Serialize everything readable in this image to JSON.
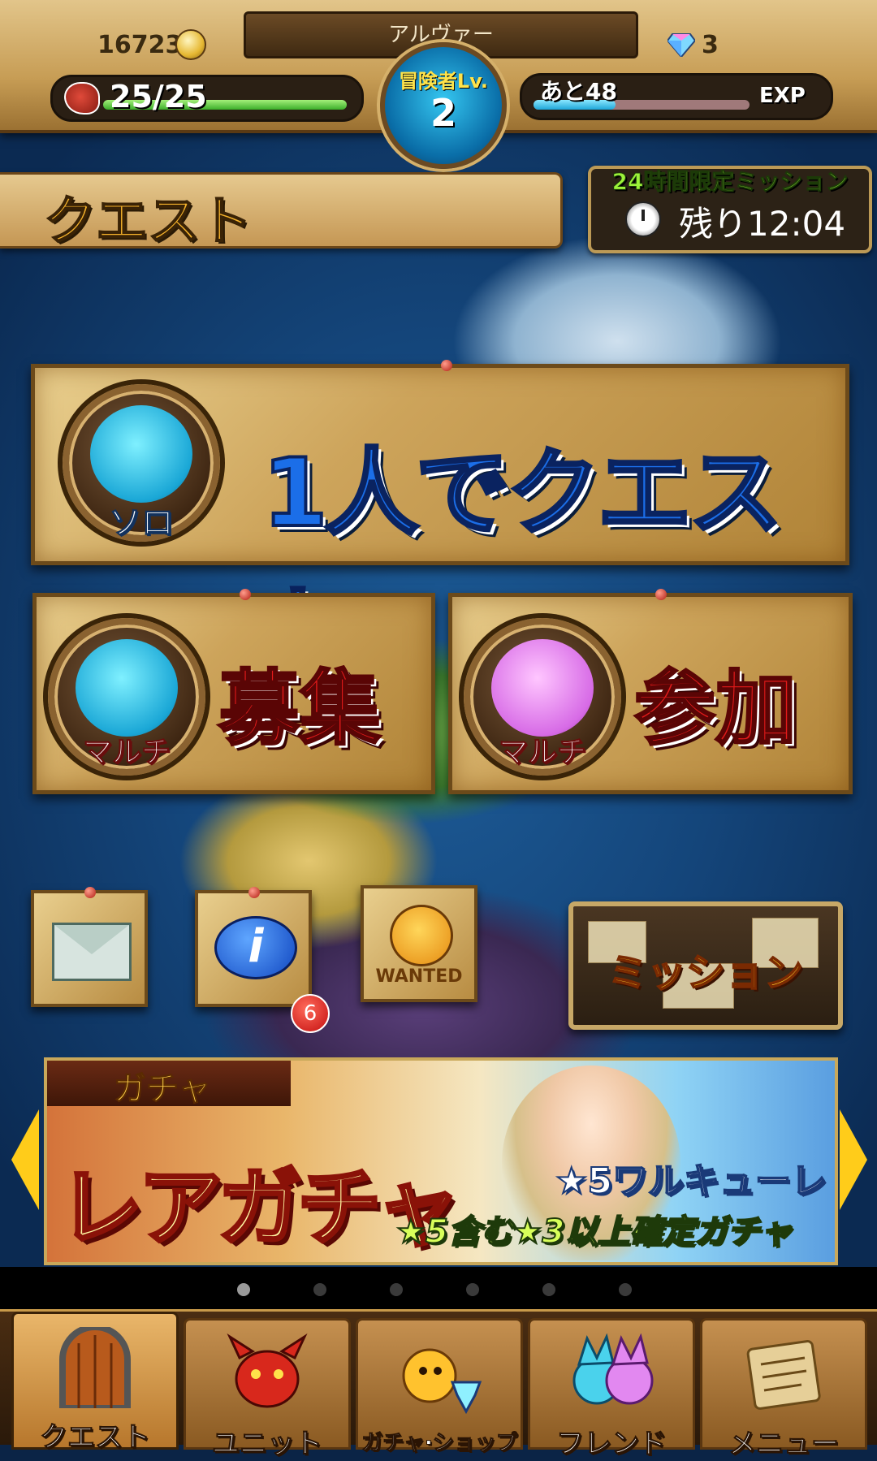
{
  "header": {
    "player_name": "アルヴァー",
    "gold": "16723",
    "gems": "3",
    "stamina_text": "25/25",
    "stamina_fraction": 1.0,
    "level_label": "冒険者Lv.",
    "level_value": "2",
    "exp_remaining_text": "あと48",
    "exp_label": "EXP",
    "exp_fraction": 0.38
  },
  "quest_header": {
    "title": "クエスト"
  },
  "timed_mission": {
    "label": "24時間限定ミッション",
    "remaining": "残り12:04"
  },
  "solo_quest": {
    "tag": "ソロ",
    "label": "1人でクエスト"
  },
  "multi_recruit": {
    "tag": "マルチ",
    "label": "募集"
  },
  "multi_join": {
    "tag": "マルチ",
    "label": "参加"
  },
  "shortcuts": {
    "info_badge_count": "6",
    "wanted_label": "WANTED",
    "mission_label": "ミッション"
  },
  "gacha_banner": {
    "tag": "ガチャ",
    "title": "レアガチャ",
    "featured": "★5ワルキューレ",
    "subtitle": "★5含む★3以上確定ガチャ"
  },
  "pager": {
    "count": 6,
    "active_index": 0
  },
  "bottom_nav": {
    "items": [
      {
        "label": "クエスト",
        "icon": "door-icon",
        "active": true
      },
      {
        "label": "ユニット",
        "icon": "dragon-icon",
        "active": false
      },
      {
        "label": "ガチャ·ショップ",
        "icon": "gacha-shop-icon",
        "active": false
      },
      {
        "label": "フレンド",
        "icon": "friends-icon",
        "active": false
      },
      {
        "label": "メニュー",
        "icon": "scroll-icon",
        "active": false
      }
    ]
  },
  "colors": {
    "stamina_fill": "#3cae2a",
    "exp_fill": "#1fa6d8",
    "solo_text": "#1b6ee8",
    "multi_text": "#e21a1a",
    "accent_gold": "#ffcc1a"
  }
}
